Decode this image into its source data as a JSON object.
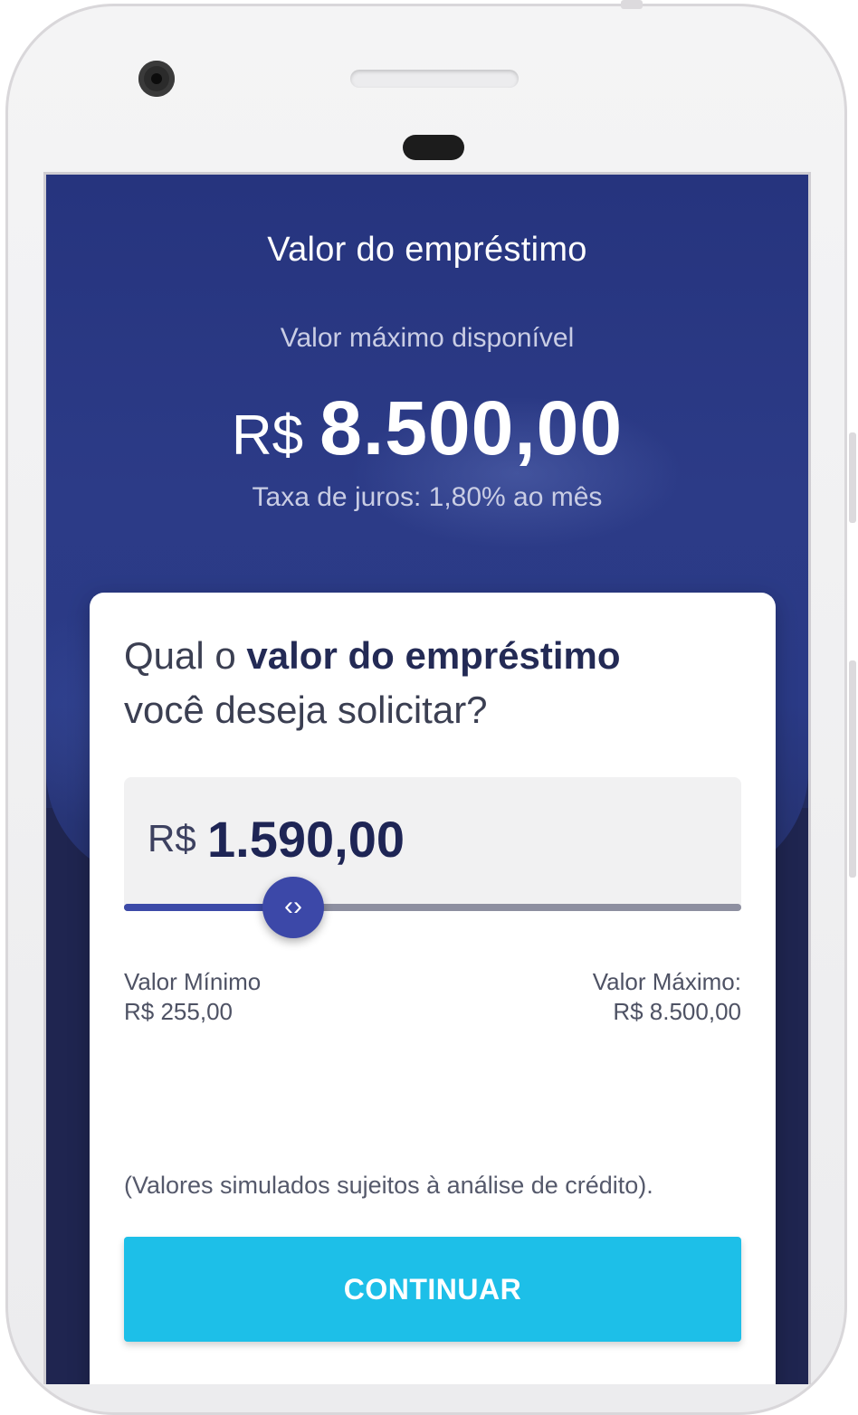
{
  "header": {
    "title": "Valor do empréstimo",
    "max_label": "Valor máximo disponível",
    "currency": "R$",
    "max_amount": "8.500,00",
    "interest_rate": "Taxa de juros:  1,80% ao mês"
  },
  "card": {
    "question_start": "Qual o ",
    "question_bold": "valor do empréstimo",
    "question_end": "você deseja solicitar?",
    "selected_currency": "R$",
    "selected_amount": "1.590,00",
    "slider_value": 1590,
    "slider_min": 255,
    "slider_max": 8500,
    "slider_icon": "chevron-left-right-icon",
    "min_label": "Valor Mínimo",
    "min_value": "R$ 255,00",
    "max_label": "Valor Máximo:",
    "max_value": "R$ 8.500,00",
    "disclaimer": "(Valores simulados sujeitos à análise de crédito).",
    "continue_label": "CONTINUAR"
  },
  "colors": {
    "hero_blue": "#2a3a86",
    "accent": "#3c48a8",
    "button": "#1dbfe8"
  }
}
